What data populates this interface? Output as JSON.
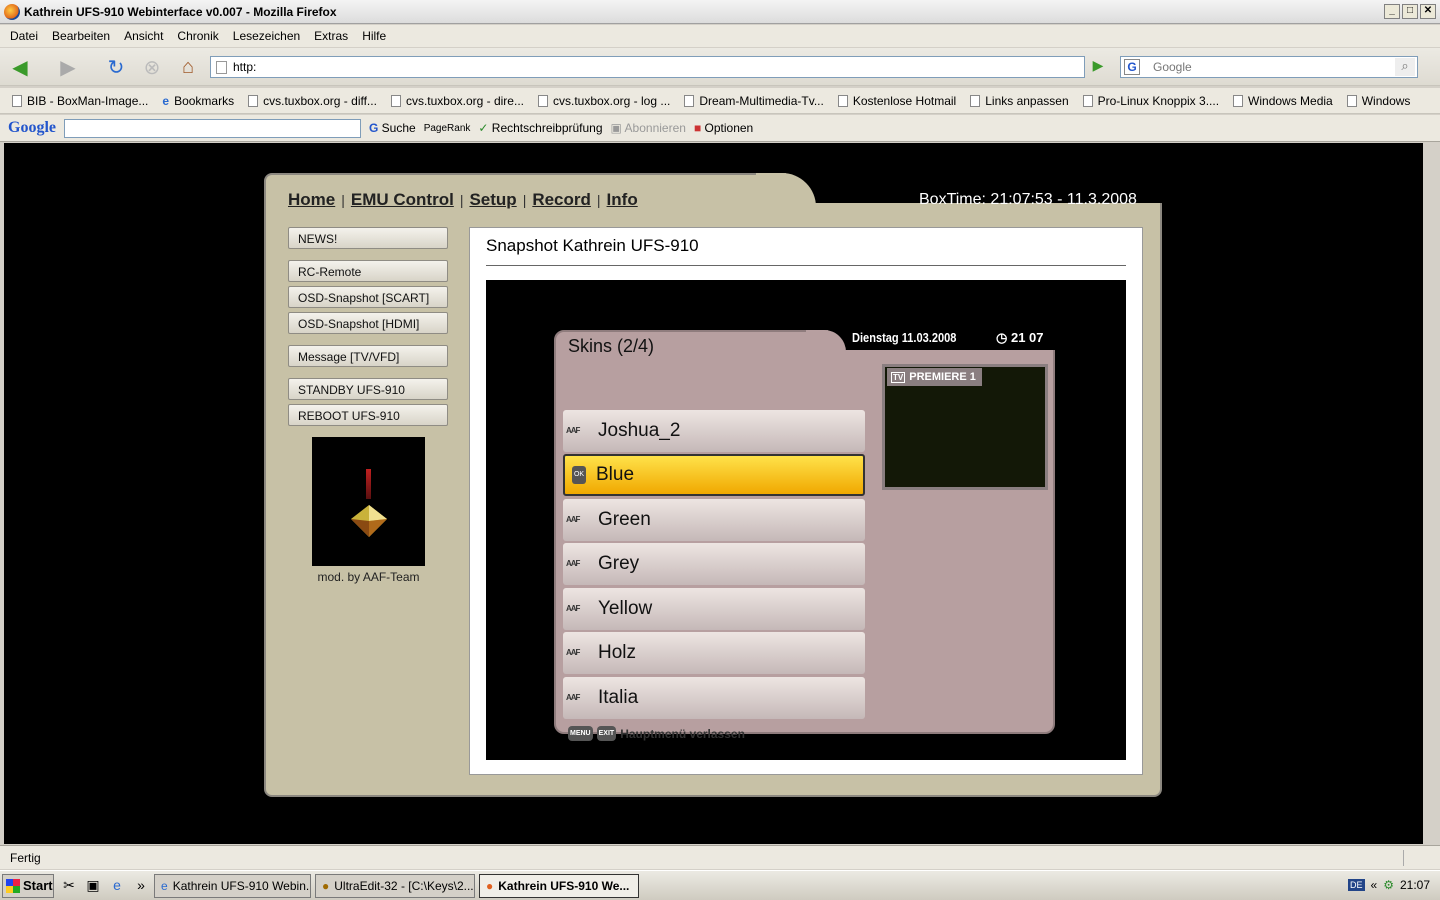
{
  "window": {
    "title": "Kathrein UFS-910 Webinterface v0.007 - Mozilla Firefox"
  },
  "menubar": [
    "Datei",
    "Bearbeiten",
    "Ansicht",
    "Chronik",
    "Lesezeichen",
    "Extras",
    "Hilfe"
  ],
  "navbar": {
    "url": "http:",
    "search_placeholder": "Google"
  },
  "bookmarks": [
    "BIB - BoxMan-Image...",
    "Bookmarks",
    "cvs.tuxbox.org - diff...",
    "cvs.tuxbox.org - dire...",
    "cvs.tuxbox.org - log ...",
    "Dream-Multimedia-Tv...",
    "Kostenlose Hotmail",
    "Links anpassen",
    "Pro-Linux Knoppix 3....",
    "Windows Media",
    "Windows"
  ],
  "google_toolbar": {
    "logo": "Google",
    "suche": "Suche",
    "pagerank": "PageRank",
    "spell": "Rechtschreibprüfung",
    "subscribe": "Abonnieren",
    "options": "Optionen"
  },
  "page": {
    "nav": [
      "Home",
      "EMU Control",
      "Setup",
      "Record",
      "Info"
    ],
    "boxtime": "BoxTime: 21:07:53 - 11.3.2008",
    "side_buttons": [
      "NEWS!",
      "RC-Remote",
      "OSD-Snapshot [SCART]",
      "OSD-Snapshot [HDMI]",
      "Message [TV/VFD]",
      "STANDBY UFS-910",
      "REBOOT UFS-910"
    ],
    "mod_by": "mod. by AAF-Team",
    "snapshot_title": "Snapshot Kathrein UFS-910"
  },
  "osd": {
    "title": "Skins (2/4)",
    "date": "Dienstag 11.03.2008",
    "clock": "21  07",
    "items": [
      "Joshua_2",
      "Blue",
      "Green",
      "Grey",
      "Yellow",
      "Holz",
      "Italia"
    ],
    "selected_index": 1,
    "preview_label": "PREMIERE 1",
    "footer": "Hauptmenü verlassen",
    "colors": {
      "bg": "#b79fa0",
      "selected": "#f7c61a"
    }
  },
  "statusbar": {
    "text": "Fertig"
  },
  "taskbar": {
    "start": "Start",
    "tasks": [
      "Kathrein UFS-910 Webin...",
      "UltraEdit-32 - [C:\\Keys\\2...",
      "Kathrein UFS-910 We..."
    ],
    "lang": "DE",
    "time": "21:07"
  }
}
